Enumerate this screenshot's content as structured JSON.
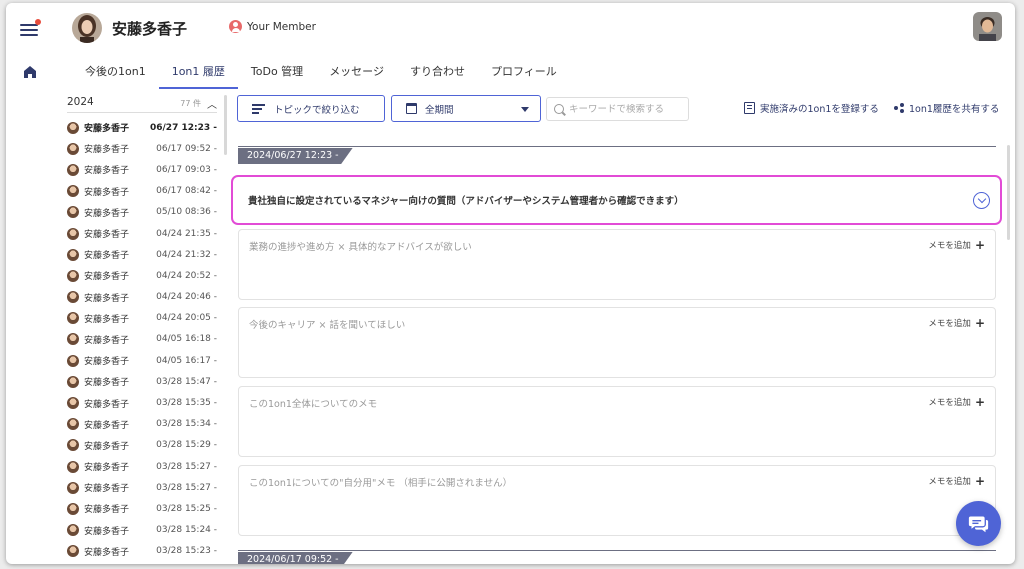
{
  "header": {
    "user_name": "安藤多香子",
    "member_label": "Your Member"
  },
  "tabs": [
    {
      "label": "今後の1on1",
      "active": false
    },
    {
      "label": "1on1 履歴",
      "active": true
    },
    {
      "label": "ToDo 管理",
      "active": false
    },
    {
      "label": "メッセージ",
      "active": false
    },
    {
      "label": "すり合わせ",
      "active": false
    },
    {
      "label": "プロフィール",
      "active": false
    }
  ],
  "history": {
    "year": "2024",
    "count": "77 件",
    "items": [
      {
        "name": "安藤多香子",
        "date": "06/27 12:23 -",
        "active": true
      },
      {
        "name": "安藤多香子",
        "date": "06/17 09:52 -"
      },
      {
        "name": "安藤多香子",
        "date": "06/17 09:03 -"
      },
      {
        "name": "安藤多香子",
        "date": "06/17 08:42 -"
      },
      {
        "name": "安藤多香子",
        "date": "05/10 08:36 -"
      },
      {
        "name": "安藤多香子",
        "date": "04/24 21:35 -"
      },
      {
        "name": "安藤多香子",
        "date": "04/24 21:32 -"
      },
      {
        "name": "安藤多香子",
        "date": "04/24 20:52 -"
      },
      {
        "name": "安藤多香子",
        "date": "04/24 20:46 -"
      },
      {
        "name": "安藤多香子",
        "date": "04/24 20:05 -"
      },
      {
        "name": "安藤多香子",
        "date": "04/05 16:18 -"
      },
      {
        "name": "安藤多香子",
        "date": "04/05 16:17 -"
      },
      {
        "name": "安藤多香子",
        "date": "03/28 15:47 -"
      },
      {
        "name": "安藤多香子",
        "date": "03/28 15:35 -"
      },
      {
        "name": "安藤多香子",
        "date": "03/28 15:34 -"
      },
      {
        "name": "安藤多香子",
        "date": "03/28 15:29 -"
      },
      {
        "name": "安藤多香子",
        "date": "03/28 15:27 -"
      },
      {
        "name": "安藤多香子",
        "date": "03/28 15:27 -"
      },
      {
        "name": "安藤多香子",
        "date": "03/28 15:25 -"
      },
      {
        "name": "安藤多香子",
        "date": "03/28 15:24 -"
      },
      {
        "name": "安藤多香子",
        "date": "03/28 15:23 -"
      }
    ]
  },
  "toolbar": {
    "filter_label": "トピックで絞り込む",
    "period_label": "全期間",
    "search_placeholder": "キーワードで検索する",
    "register_label": "実施済みの1on1を登録する",
    "share_label": "1on1履歴を共有する"
  },
  "sessions": [
    {
      "date_label": "2024/06/27 12:23 -"
    },
    {
      "date_label": "2024/06/17 09:52 -"
    }
  ],
  "accordion": {
    "question": "貴社独自に設定されているマネジャー向けの質問（アドバイザーやシステム管理者から確認できます）"
  },
  "memo_cards": [
    {
      "title": "業務の進捗や進め方 × 具体的なアドバイスが欲しい",
      "add_label": "メモを追加"
    },
    {
      "title": "今後のキャリア × 話を聞いてほしい",
      "add_label": "メモを追加"
    },
    {
      "title": "この1on1全体についてのメモ",
      "add_label": "メモを追加"
    },
    {
      "title": "この1on1についての\"自分用\"メモ （相手に公開されません）",
      "add_label": "メモを追加"
    }
  ],
  "colors": {
    "accent": "#4f64d6",
    "navy": "#2f3a6b",
    "highlight": "#e24bd6",
    "notification": "#e74c3c"
  },
  "icons": [
    "hamburger-icon",
    "home-icon",
    "member-icon",
    "filter-lines-icon",
    "calendar-icon",
    "search-icon",
    "document-icon",
    "share-icon",
    "chevron-down-icon",
    "chat-icon"
  ]
}
